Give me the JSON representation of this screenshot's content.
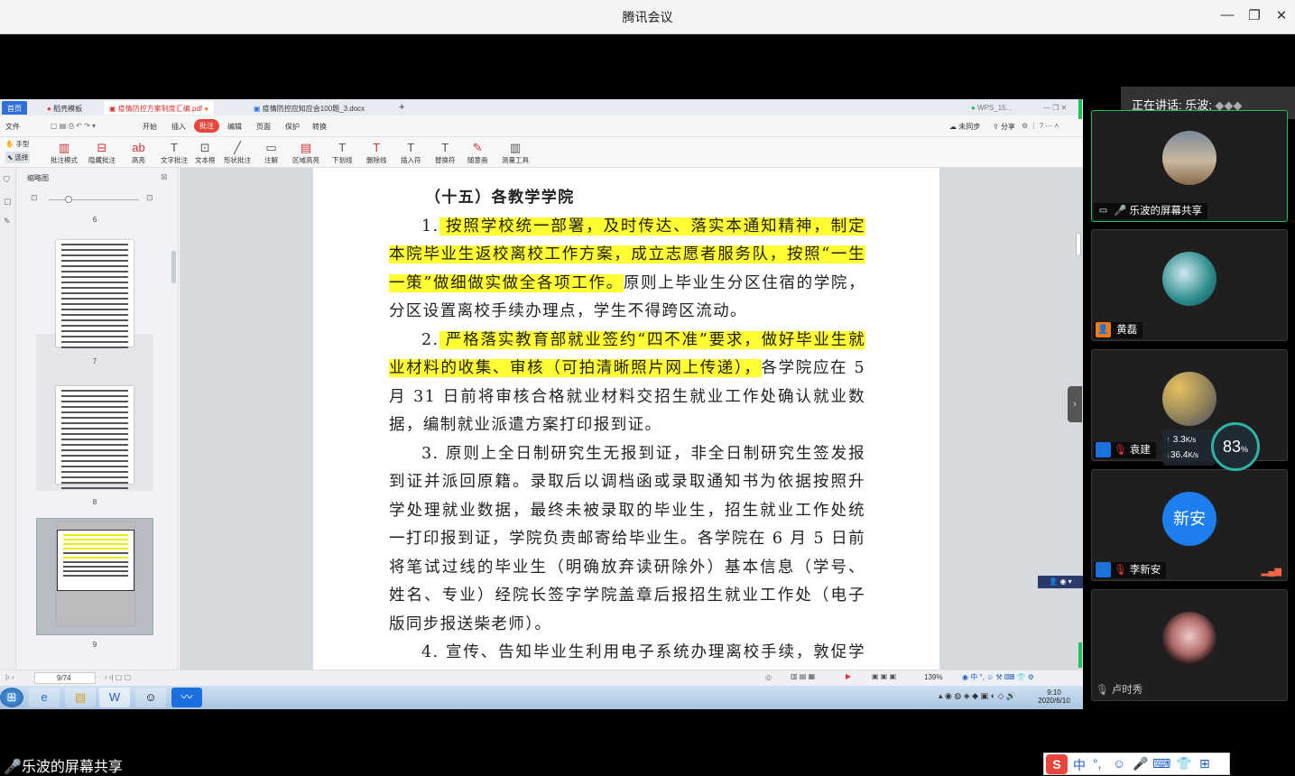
{
  "window": {
    "title": "腾讯会议",
    "minimize_glyph": "—",
    "maximize_glyph": "❐",
    "close_glyph": "✕"
  },
  "wps": {
    "tabs": [
      {
        "label": "首页"
      },
      {
        "label": "稻壳模板"
      },
      {
        "label": "疫情防控方案制度汇编.pdf"
      },
      {
        "label": "疫情防控应知应会100题_3.docx"
      },
      {
        "label": "+"
      },
      {
        "label": "WPS_15..."
      }
    ],
    "menu": [
      "文件",
      "开始",
      "插入",
      "批注",
      "编辑",
      "页面",
      "保护",
      "转换"
    ],
    "menu_right": [
      "未同步",
      "分享"
    ],
    "ribbon_left": [
      "手型",
      "选择"
    ],
    "ribbon_tools": [
      "批注模式",
      "隐藏批注",
      "高亮",
      "文字批注",
      "文本框",
      "形状批注",
      "注解",
      "区域高亮",
      "下划线",
      "删除线",
      "插入符",
      "替换符",
      "随意画",
      "测量工具"
    ],
    "sidebar_title": "缩略图",
    "thumb_numbers": [
      "6",
      "7",
      "8",
      "9"
    ],
    "page_indicator": "9/74",
    "zoom": "139%"
  },
  "document": {
    "heading": "（十五）各教学学院",
    "p1_num": "1.",
    "p1_hl": " 按照学校统一部署，及时传达、落实本通知精神，制定本院毕业生返校离校工作方案，成立志愿者服务队，按照“一生一策”做细做实做全各项工作。",
    "p1_rest": "原则上毕业生分区住宿的学院，分区设置离校手续办理点，学生不得跨区流动。",
    "p2_num": "2.",
    "p2_hl": " 严格落实教育部就业签约“四不准”要求，做好毕业生就业材料的收集、审核（可拍清晰照片网上传递），",
    "p2_rest": "各学院应在 5 月 31 日前将审核合格就业材料交招生就业工作处确认就业数据，编制就业派遣方案打印报到证。",
    "p3": "3. 原则上全日制研究生无报到证，非全日制研究生签发报到证并派回原籍。录取后以调档函或录取通知书为依据按照升学处理就业数据，最终未被录取的毕业生，招生就业工作处统一打印报到证，学院负责邮寄给毕业生。各学院在 6 月 5 日前将笔试过线的毕业生（明确放弃读研除外）基本信息（学号、姓名、专业）经院长签字学院盖章后报招生就业工作处（电子版同步报送柴老师）。",
    "p4": "4. 宣传、告知毕业生利用电子系统办理离校手续，敦促学生"
  },
  "taskbar": {
    "time": "9:10",
    "date": "2020/6/10"
  },
  "meeting": {
    "speaking": "正在讲话: 乐波;",
    "participants": [
      {
        "name": "乐波的屏幕共享",
        "active": true
      },
      {
        "name": "黄磊"
      },
      {
        "name": "袁建"
      },
      {
        "name": "新安",
        "sub": "李新安"
      },
      {
        "name": "卢时秀"
      }
    ],
    "net_up": "3.3",
    "net_down": "36.4",
    "net_unit": "K/s",
    "cpu_percent": "83",
    "cpu_unit": "%",
    "bottom_label": "乐波的屏幕共享",
    "ime_items": [
      "中",
      "°,",
      "☺",
      "🎤",
      "⌨",
      "👕",
      "⊞"
    ]
  }
}
